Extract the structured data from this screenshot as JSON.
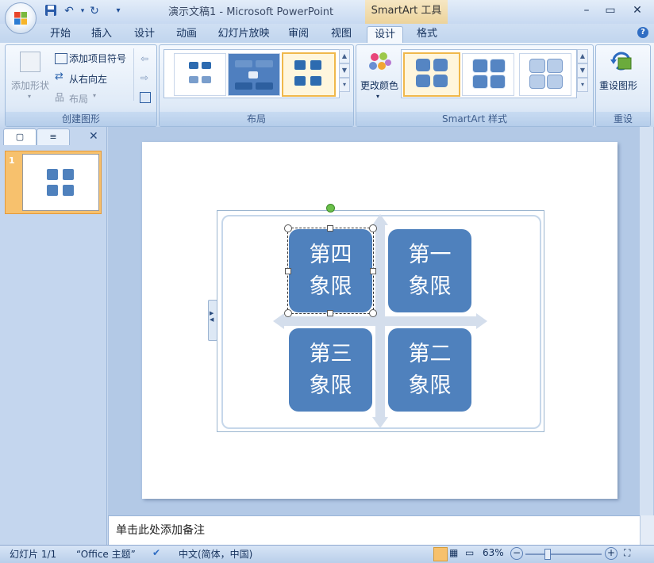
{
  "window": {
    "title": "演示文稿1 - Microsoft PowerPoint",
    "context_tab_title": "SmartArt 工具"
  },
  "tabs": [
    {
      "label": "开始"
    },
    {
      "label": "插入"
    },
    {
      "label": "设计"
    },
    {
      "label": "动画"
    },
    {
      "label": "幻灯片放映"
    },
    {
      "label": "审阅"
    },
    {
      "label": "视图"
    },
    {
      "label": "设计",
      "active": true
    },
    {
      "label": "格式"
    }
  ],
  "ribbon": {
    "create_graphic": {
      "label": "创建图形",
      "add_shape": "添加形状",
      "add_bullet": "添加项目符号",
      "right_to_left": "从右向左",
      "layout": "布局"
    },
    "layouts": {
      "label": "布局"
    },
    "smartart_styles": {
      "label": "SmartArt 样式",
      "change_colors": "更改颜色"
    },
    "reset": {
      "label": "重设",
      "reset_graphic": "重设图形"
    }
  },
  "slide_panel": {
    "slide_number": "1"
  },
  "slide": {
    "quadrants": [
      {
        "text": "第四象限"
      },
      {
        "text": "第一象限"
      },
      {
        "text": "第三象限"
      },
      {
        "text": "第二象限"
      }
    ]
  },
  "notes": {
    "placeholder": "单击此处添加备注"
  },
  "status": {
    "slide_info": "幻灯片 1/1",
    "theme": "“Office 主题”",
    "language": "中文(简体，中国)",
    "zoom": "63%"
  },
  "colors": {
    "accent": "#4f81bd",
    "ribbon_bg": "#dfeaf7"
  }
}
